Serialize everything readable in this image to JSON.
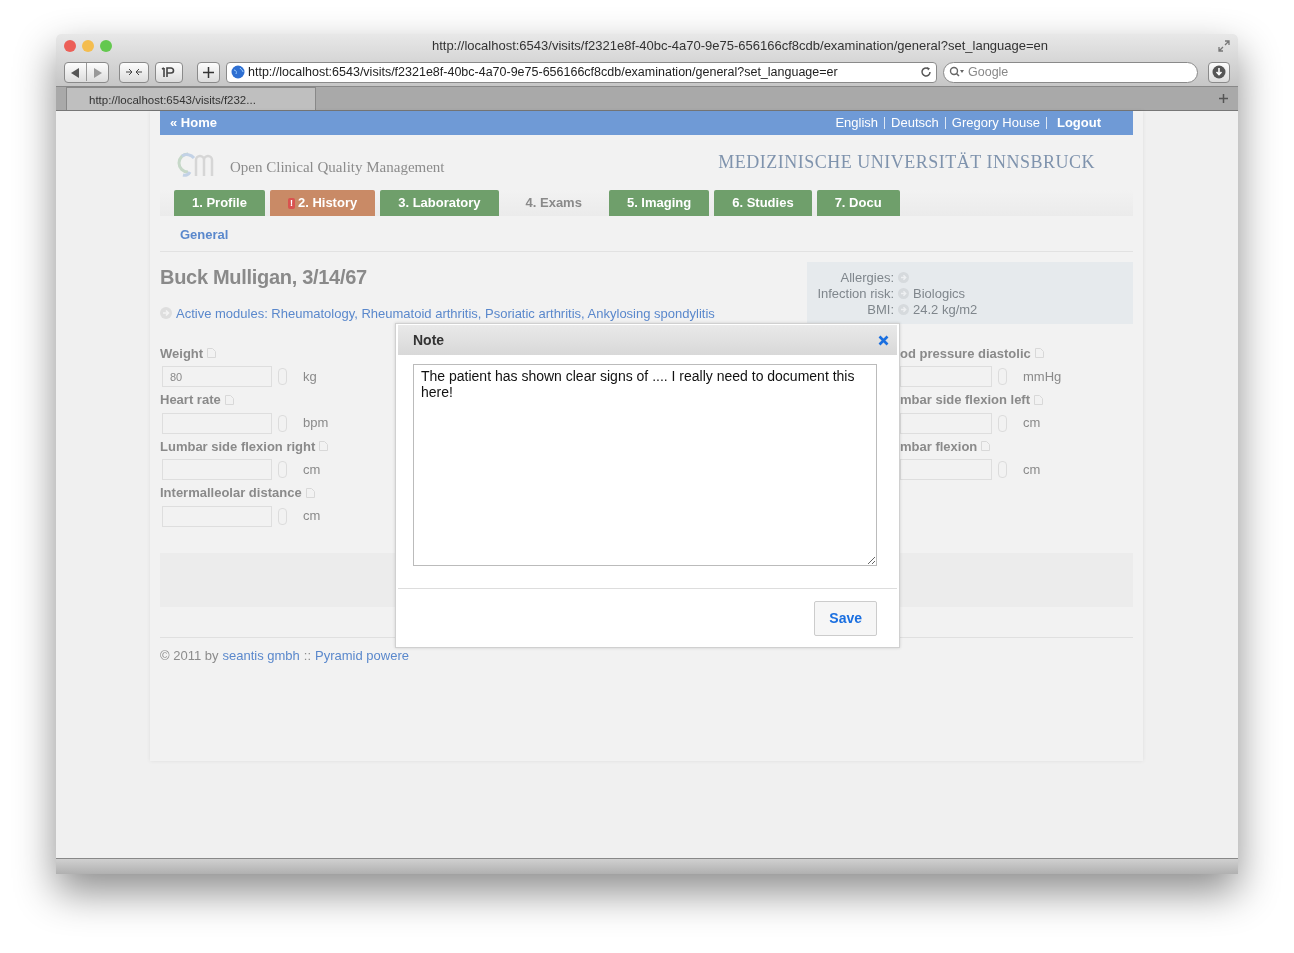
{
  "browser": {
    "title": "http://localhost:6543/visits/f2321e8f-40bc-4a70-9e75-656166cf8cdb/examination/general?set_language=en",
    "url": "http://localhost:6543/visits/f2321e8f-40bc-4a70-9e75-656166cf8cdb/examination/general?set_language=er",
    "search_placeholder": "Google",
    "tab_title": "http://localhost:6543/visits/f232..."
  },
  "topbar": {
    "home": "« Home",
    "links": [
      {
        "label": "English",
        "kind": "plain"
      },
      {
        "label": "Deutsch",
        "kind": "plain"
      },
      {
        "label": "Gregory House",
        "kind": "plain"
      },
      {
        "label": "Logout",
        "kind": "strong"
      }
    ]
  },
  "brand": {
    "tagline": "Open Clinical Quality Management",
    "institution": "MEDIZINISCHE UNIVERSITÄT INNSBRUCK"
  },
  "tabs": [
    {
      "label": "1. Profile",
      "kind": "complete",
      "selected": false
    },
    {
      "label": "2. History",
      "kind": "warning",
      "badge": "!",
      "selected": false
    },
    {
      "label": "3. Laboratory",
      "kind": "complete",
      "selected": false
    },
    {
      "label": "4. Exams",
      "kind": "complete",
      "selected": true
    },
    {
      "label": "5. Imaging",
      "kind": "complete",
      "selected": false
    },
    {
      "label": "6. Studies",
      "kind": "complete",
      "selected": false
    },
    {
      "label": "7. Docu",
      "kind": "complete",
      "selected": false
    }
  ],
  "subnav": {
    "label": "General"
  },
  "patient": {
    "name": "Buck Mulligan, 3/14/67",
    "modules": "Active modules: Rheumatology, Rheumatoid arthritis, Psoriatic arthritis, Ankylosing spondylitis"
  },
  "summary": [
    {
      "label": "Allergies:"
    },
    {
      "label": "Infection risk:",
      "value": "Biologics"
    },
    {
      "label": "BMI:",
      "value": "24.2 kg/m2"
    }
  ],
  "fields_left": [
    {
      "label": "Weight",
      "value": "80",
      "unit": "kg"
    },
    {
      "label": "Heart rate",
      "unit": "bpm"
    },
    {
      "label": "Lumbar side flexion right",
      "unit": "cm"
    },
    {
      "label": "Intermalleolar distance",
      "unit": "cm"
    }
  ],
  "fields_right": [
    {
      "label": "od pressure diastolic",
      "unit": "mmHg"
    },
    {
      "label": "mbar side flexion left",
      "unit": "cm"
    },
    {
      "label": "mbar flexion",
      "unit": "cm"
    }
  ],
  "footer": {
    "prefix": "© 2011 by",
    "company": "seantis gmbh",
    "separator": "::",
    "powered": "Pyramid powere"
  },
  "modal": {
    "title": "Note",
    "text": "The patient has shown clear signs of .... I really need to document this here!",
    "button": "Save"
  }
}
